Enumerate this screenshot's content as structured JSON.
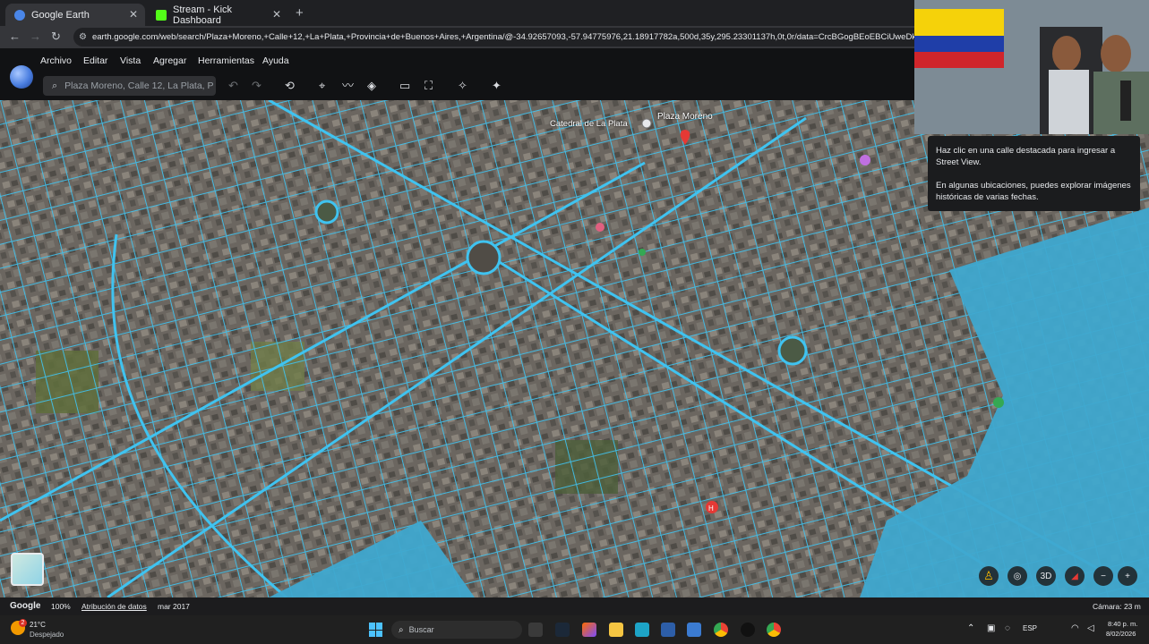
{
  "browser": {
    "tabs": [
      {
        "label": "Google Earth",
        "active": true,
        "favicon_color": "#4a86e8"
      },
      {
        "label": "Stream - Kick Dashboard",
        "active": false,
        "favicon_color": "#53fc18"
      }
    ],
    "url": "earth.google.com/web/search/Plaza+Moreno,+Calle+12,+La+Plata,+Provincia+de+Buenos+Aires,+Argentina/@-34.92657093,-57.94775976,21.18917782a,500d,35y,295.23301137h,0t,0r/data=CrcBGogBEoEBCiUweDk1YTJlN"
  },
  "app": {
    "menu": [
      "Archivo",
      "Editar",
      "Vista",
      "Agregar",
      "Herramientas",
      "Ayuda"
    ],
    "search_placeholder": "Plaza Moreno, Calle 12, La Plata, P"
  },
  "map": {
    "labels": {
      "plaza": "Plaza Moreno",
      "cathedral": "Catedral de La Plata"
    },
    "highlight_color": "#3fc3f0"
  },
  "tooltip": {
    "line1": "Haz clic en una calle destacada para ingresar a Street View.",
    "line2": "En algunas ubicaciones, puedes explorar imágenes históricas de varias fechas."
  },
  "status": {
    "google": "Google",
    "zoom": "100%",
    "attribution": "Atribución de datos",
    "date": "mar 2017",
    "camera": "Cámara: 23 m"
  },
  "controls": {
    "three_d": "3D"
  },
  "taskbar": {
    "temp": "21°C",
    "weather": "Despejado",
    "weather_badge": "2",
    "search": "Buscar",
    "lang": "ESP",
    "time": "8:40 p. m.",
    "date": "8/02/2026"
  }
}
